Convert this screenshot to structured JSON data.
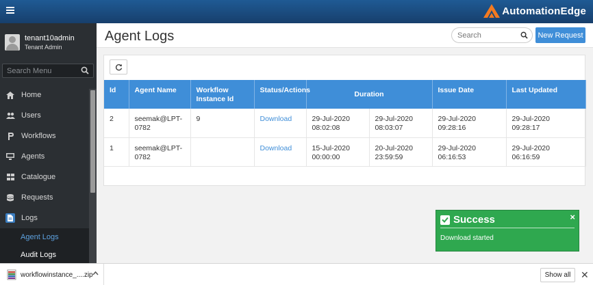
{
  "topbar": {
    "brand": "AutomationEdge",
    "brand_color": "#f47a20",
    "bar_color": "#1f5a94"
  },
  "user": {
    "name": "tenant10admin",
    "role": "Tenant Admin"
  },
  "menu_search": {
    "placeholder": "Search Menu"
  },
  "nav": [
    {
      "label": "Home",
      "icon": "home-icon"
    },
    {
      "label": "Users",
      "icon": "users-icon"
    },
    {
      "label": "Workflows",
      "icon": "workflow-icon"
    },
    {
      "label": "Agents",
      "icon": "monitor-icon"
    },
    {
      "label": "Catalogue",
      "icon": "grid-icon"
    },
    {
      "label": "Requests",
      "icon": "database-icon"
    },
    {
      "label": "Logs",
      "icon": "file-icon",
      "active": true
    }
  ],
  "subnav": [
    {
      "label": "Agent Logs",
      "active": true
    },
    {
      "label": "Audit Logs"
    }
  ],
  "page": {
    "title": "Agent Logs",
    "search_placeholder": "Search",
    "new_request": "New Request",
    "accent": "#3f8ed8"
  },
  "table": {
    "headers": [
      "Id",
      "Agent Name",
      "Workflow Instance Id",
      "Status/Actions",
      "Duration",
      "Issue Date",
      "Last Updated"
    ],
    "rows": [
      {
        "id": "2",
        "agent": "seemak@LPT-0782",
        "instance": "9",
        "action": "Download",
        "start": "29-Jul-2020 08:02:08",
        "end": "29-Jul-2020 08:03:07",
        "issue": "29-Jul-2020 09:28:16",
        "updated": "29-Jul-2020 09:28:17"
      },
      {
        "id": "1",
        "agent": "seemak@LPT-0782",
        "instance": "",
        "action": "Download",
        "start": "15-Jul-2020 00:00:00",
        "end": "20-Jul-2020 23:59:59",
        "issue": "29-Jul-2020 06:16:53",
        "updated": "29-Jul-2020 06:16:59"
      }
    ]
  },
  "toast": {
    "title": "Success",
    "message": "Download started",
    "close": "×",
    "color": "#2fa84f"
  },
  "download_bar": {
    "file": "workflowinstance_....zip",
    "show_all": "Show all",
    "close": "✕"
  }
}
